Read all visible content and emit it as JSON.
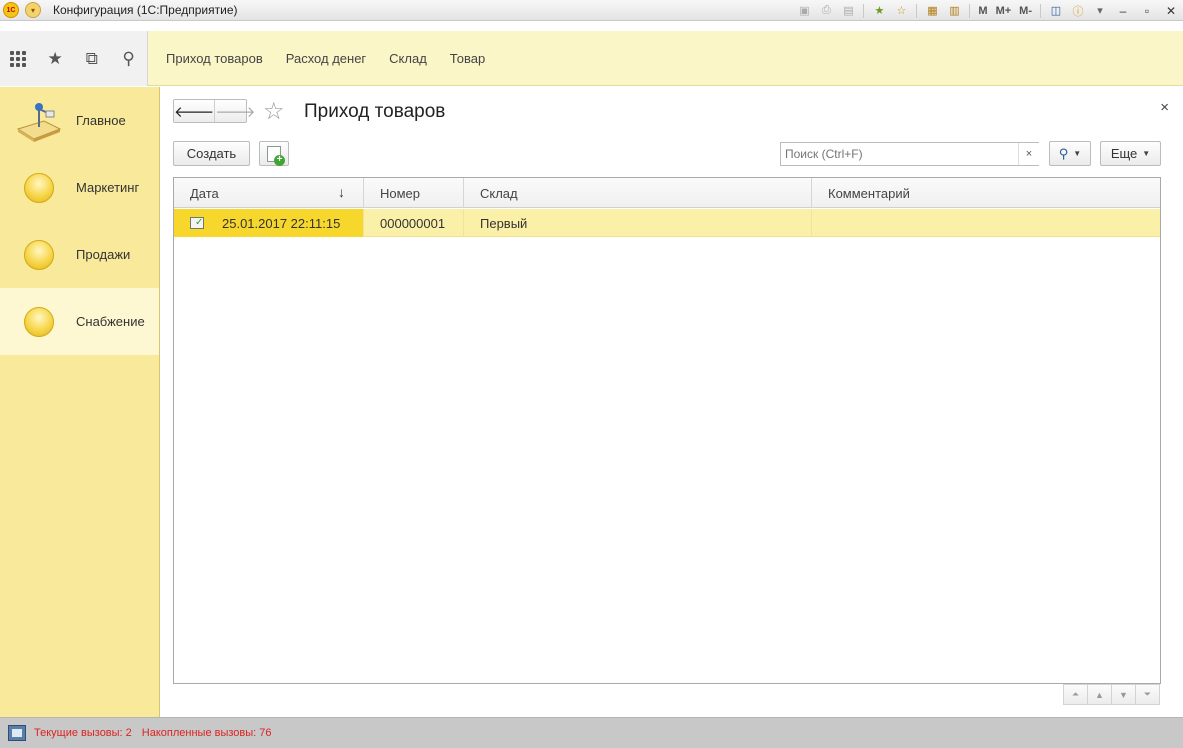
{
  "window": {
    "title": "Конфигурация  (1С:Предприятие)",
    "toolbar_m_labels": [
      "M",
      "M+",
      "M-"
    ]
  },
  "topnav": {
    "items": [
      "Приход товаров",
      "Расход денег",
      "Склад",
      "Товар"
    ]
  },
  "sidebar": {
    "items": [
      {
        "label": "Главное",
        "icon": "desk-lamp-icon",
        "active": false
      },
      {
        "label": "Маркетинг",
        "icon": "section-ball-icon",
        "active": false
      },
      {
        "label": "Продажи",
        "icon": "section-ball-icon",
        "active": false
      },
      {
        "label": "Снабжение",
        "icon": "section-ball-icon",
        "active": true
      }
    ]
  },
  "form": {
    "title": "Приход товаров",
    "create_label": "Создать",
    "search_placeholder": "Поиск (Ctrl+F)",
    "more_label": "Еще",
    "clear_glyph": "×",
    "close_glyph": "×"
  },
  "table": {
    "columns": [
      "Дата",
      "Номер",
      "Склад",
      "Комментарий"
    ],
    "sort_column": "Дата",
    "sort_direction": "descending",
    "rows": [
      {
        "date": "25.01.2017 22:11:15",
        "number": "000000001",
        "warehouse": "Первый",
        "comment": ""
      }
    ]
  },
  "status": {
    "current_calls": "Текущие вызовы: 2",
    "accumulated_calls": "Накопленные вызовы: 76"
  },
  "colors": {
    "sidebar_bg": "#f8e99b",
    "topbar_bg": "#fbf6c8",
    "selected_row": "#fbf0a8",
    "selected_cell": "#f7d72c",
    "status_text": "#dd2222"
  }
}
